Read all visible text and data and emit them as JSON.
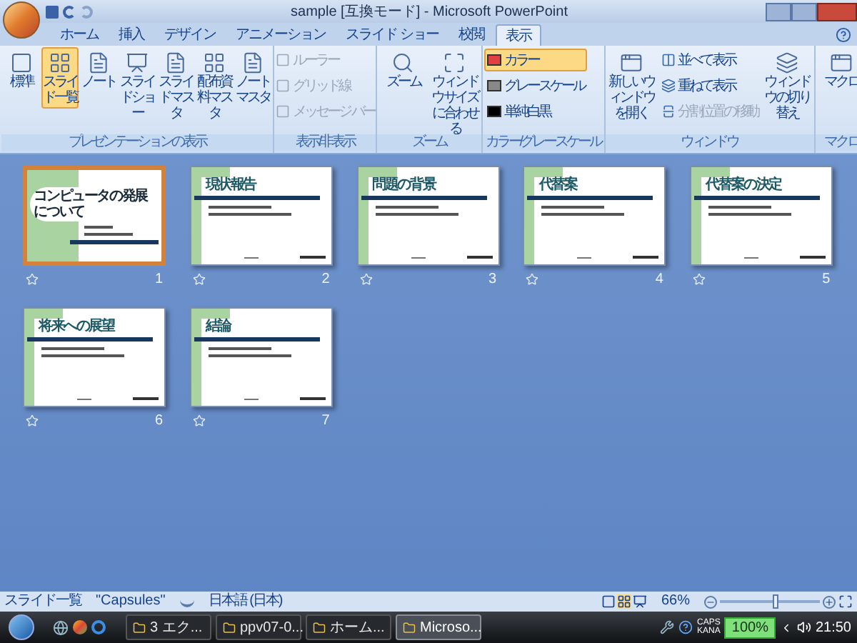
{
  "window": {
    "title": "sample [互換モード] - Microsoft PowerPoint"
  },
  "tabs": [
    {
      "label": "ホーム",
      "selected": false
    },
    {
      "label": "挿入",
      "selected": false
    },
    {
      "label": "デザイン",
      "selected": false
    },
    {
      "label": "アニメーション",
      "selected": false
    },
    {
      "label": "スライド ショー",
      "selected": false
    },
    {
      "label": "校閲",
      "selected": false
    },
    {
      "label": "表示",
      "selected": true
    }
  ],
  "ribbon": {
    "groups": [
      {
        "label": "プレゼンテーションの表示",
        "items": [
          {
            "kind": "large",
            "label": "標準",
            "selected": false
          },
          {
            "kind": "large",
            "label": "スライド一覧",
            "selected": true
          },
          {
            "kind": "large",
            "label": "ノート",
            "selected": false
          },
          {
            "kind": "large",
            "label": "スライドショー",
            "selected": false
          },
          {
            "kind": "large",
            "label": "スライドマスタ",
            "selected": false
          },
          {
            "kind": "large",
            "label": "配布資料マスタ",
            "selected": false
          },
          {
            "kind": "large",
            "label": "ノートマスタ",
            "selected": false
          }
        ]
      },
      {
        "label": "表示/非表示",
        "items": [
          {
            "kind": "check",
            "label": "ルーラー",
            "checked": false,
            "disabled": true
          },
          {
            "kind": "check",
            "label": "グリッド線",
            "checked": false,
            "disabled": true
          },
          {
            "kind": "check",
            "label": "メッセージ バー",
            "checked": false,
            "disabled": true
          }
        ]
      },
      {
        "label": "ズーム",
        "items": [
          {
            "kind": "large",
            "label": "ズーム",
            "selected": false
          },
          {
            "kind": "large",
            "label": "ウィンドウ サイズに合わせる",
            "selected": false
          }
        ]
      },
      {
        "label": "カラー/グレースケール",
        "items": [
          {
            "kind": "small",
            "label": "カラー",
            "selected": true,
            "disabled": false
          },
          {
            "kind": "small",
            "label": "グレースケール",
            "selected": false,
            "disabled": false
          },
          {
            "kind": "small",
            "label": "単純白黒",
            "selected": false,
            "disabled": false
          }
        ]
      },
      {
        "label": "ウィンドウ",
        "items": [
          {
            "kind": "large",
            "label": "新しいウィンドウを開く",
            "selected": false
          },
          {
            "kind": "small",
            "label": "並べて表示",
            "selected": false,
            "disabled": false
          },
          {
            "kind": "small",
            "label": "重ねて表示",
            "selected": false,
            "disabled": false
          },
          {
            "kind": "small",
            "label": "分割位置の移動",
            "selected": false,
            "disabled": true
          },
          {
            "kind": "large",
            "label": "ウィンドウの切り替え",
            "selected": false
          }
        ]
      },
      {
        "label": "マクロ",
        "items": [
          {
            "kind": "large",
            "label": "マクロ",
            "selected": false
          }
        ]
      }
    ]
  },
  "slides": [
    {
      "number": "1",
      "kind": "title",
      "title": "コンピュータの発展について",
      "selected": true
    },
    {
      "number": "2",
      "kind": "content",
      "title": "現状報告",
      "selected": false
    },
    {
      "number": "3",
      "kind": "content",
      "title": "問題の背景",
      "selected": false
    },
    {
      "number": "4",
      "kind": "content",
      "title": "代替案",
      "selected": false
    },
    {
      "number": "5",
      "kind": "content",
      "title": "代替案の決定",
      "selected": false
    },
    {
      "number": "6",
      "kind": "content",
      "title": "将来への展望",
      "selected": false
    },
    {
      "number": "7",
      "kind": "content",
      "title": "結論",
      "selected": false
    }
  ],
  "status_bar": {
    "view": "スライド一覧",
    "theme": "\"Capsules\"",
    "language": "日本語 (日本)",
    "zoom": "66%",
    "zoom_slider": {
      "level": 0.55
    }
  },
  "taskbar": {
    "buttons": [
      {
        "label": "3 エク...",
        "selected": false
      },
      {
        "label": "ppv07-0...",
        "selected": false
      },
      {
        "label": "ホーム...",
        "selected": false
      },
      {
        "label": "Microso...",
        "selected": true
      }
    ],
    "caps": "CAPS",
    "kana": "KANA",
    "battery": "100%",
    "time": "21:50"
  }
}
